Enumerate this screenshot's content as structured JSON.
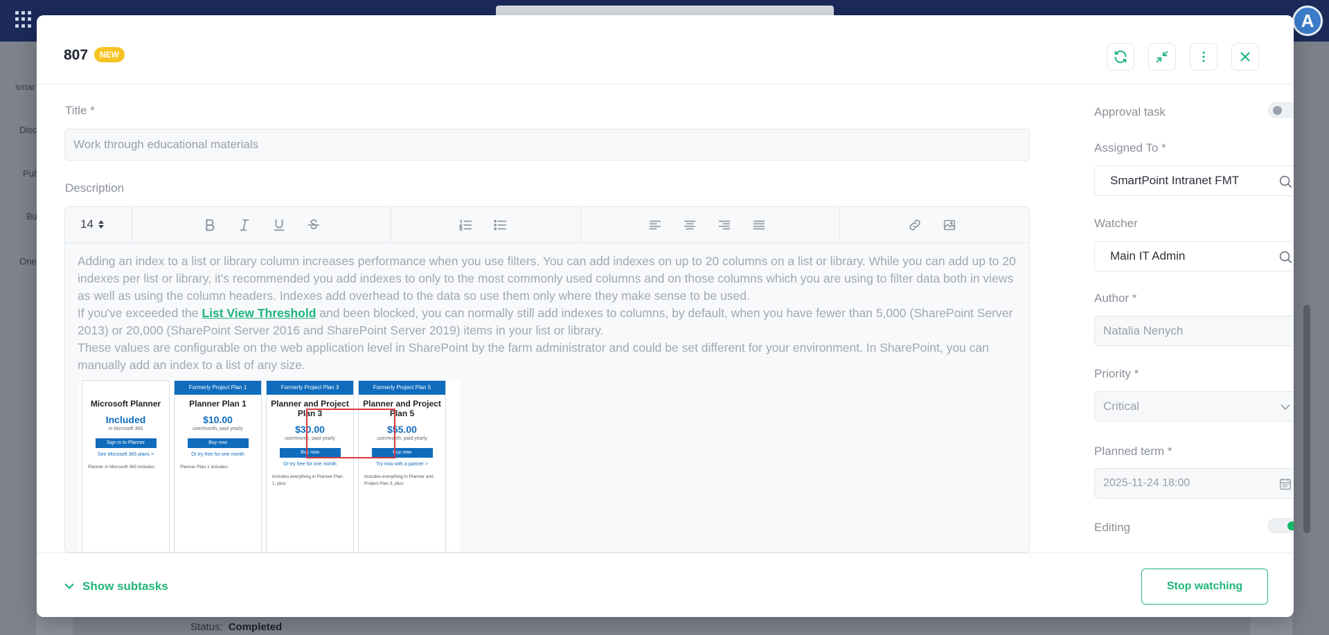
{
  "background": {
    "avatar_letter": "A",
    "sidebar_labels": [
      "smar",
      "Disc",
      "Pub",
      "Bu",
      "One"
    ],
    "status_label": "Status:",
    "status_value": "Completed"
  },
  "task": {
    "id": "807",
    "badge": "NEW"
  },
  "fields": {
    "title_label": "Title *",
    "title_value": "Work through educational materials",
    "description_label": "Description",
    "font_size": "14",
    "approval_label": "Approval task",
    "approval_on": false,
    "assigned_label": "Assigned To *",
    "assigned_value": "SmartPoint Intranet FMT",
    "watcher_label": "Watcher",
    "watcher_value": "Main IT Admin",
    "author_label": "Author *",
    "author_value": "Natalia Nenych",
    "priority_label": "Priority *",
    "priority_value": "Critical",
    "planned_label": "Planned term *",
    "planned_value": "2025-11-24 18:00",
    "editing_label": "Editing",
    "editing_on": true
  },
  "description": {
    "para1": "Adding an index to a list or library column increases performance when you use filters. You can add indexes on up to 20 columns on a list or library. While you can add up to 20 indexes per list or library, it's recommended you add indexes to only to the most commonly used columns and on those columns which you are using to filter data both in views as well as using the column headers. Indexes add overhead to the data so use them only where they make sense to be used.",
    "para2_before": "If you've exceeded the ",
    "para2_link": "List View Threshold",
    "para2_after": " and been blocked, you can normally still add indexes to columns, by default, when you have fewer than 5,000 (SharePoint Server 2013) or 20,000 (SharePoint Server 2016 and SharePoint Server 2019) items in your list or library.",
    "para3": "These values are configurable on the web application level in SharePoint by the farm administrator and could be set different for your environment. In SharePoint, you can manually add an index to a list of any size."
  },
  "pricing": [
    {
      "top": "",
      "name": "Microsoft Planner",
      "price": "Included",
      "sub": "in Microsoft 365",
      "button": "Sign in to Planner",
      "link": "See Microsoft 365 plans >",
      "features": "Planner in Microsoft 365 includes:"
    },
    {
      "top": "Formerly Project Plan 1",
      "name": "Planner Plan 1",
      "price": "$10.00",
      "sub": "user/month, paid yearly",
      "button": "Buy now",
      "link": "Or try free for one month",
      "features": "Planner Plan 1 includes:"
    },
    {
      "top": "Formerly Project Plan 3",
      "name": "Planner and Project Plan 3",
      "price": "$30.00",
      "sub": "user/month, paid yearly",
      "button": "Buy now",
      "link": "Or try free for one month",
      "features": "Includes everything in Planner Plan 1, plus:"
    },
    {
      "top": "Formerly Project Plan 5",
      "name": "Planner and Project Plan 5",
      "price": "$55.00",
      "sub": "user/month, paid yearly",
      "button": "Buy now",
      "link": "Try now with a partner >",
      "features": "Includes everything in Planner and Project Plan 3, plus:"
    }
  ],
  "footer": {
    "subtasks_label": "Show subtasks",
    "stop_watching_label": "Stop watching"
  },
  "colors": {
    "accent": "#1fb57a",
    "badge": "#f6c324",
    "topbar": "#1c2a5a"
  }
}
